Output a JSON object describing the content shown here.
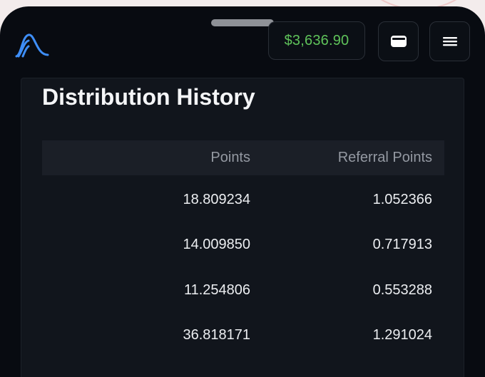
{
  "header": {
    "balance": "$3,636.90",
    "icons": {
      "logo": "brand-wave-logo",
      "wallet": "wallet-icon",
      "menu": "hamburger-menu-icon"
    },
    "colors": {
      "balance": "#5fc35a",
      "logo": "#3e8ef7"
    }
  },
  "section": {
    "title": "Distribution History"
  },
  "table": {
    "columns": [
      "Points",
      "Referral Points"
    ],
    "rows": [
      [
        "18.809234",
        "1.052366"
      ],
      [
        "14.009850",
        "0.717913"
      ],
      [
        "11.254806",
        "0.553288"
      ],
      [
        "36.818171",
        "1.291024"
      ]
    ]
  }
}
